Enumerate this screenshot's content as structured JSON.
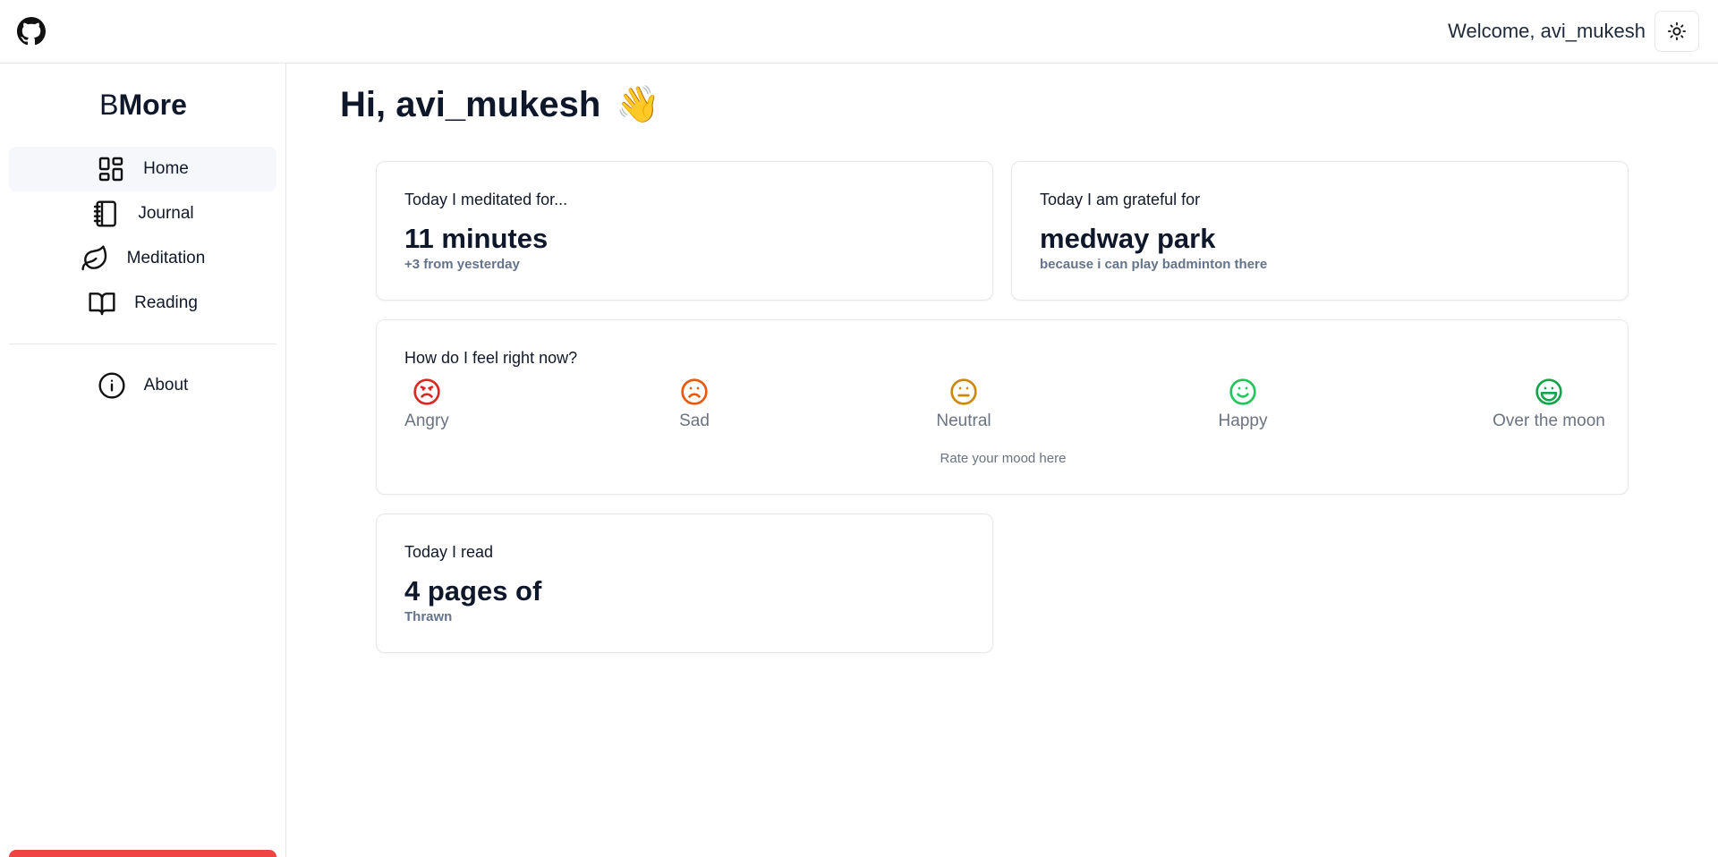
{
  "header": {
    "welcome": "Welcome, avi_mukesh",
    "github_icon": "github-icon",
    "theme_icon": "sun-icon"
  },
  "sidebar": {
    "brand_light": "B",
    "brand_bold": "More",
    "items": [
      {
        "label": "Home",
        "icon": "grid-icon"
      },
      {
        "label": "Journal",
        "icon": "notebook-icon"
      },
      {
        "label": "Meditation",
        "icon": "leaf-icon"
      },
      {
        "label": "Reading",
        "icon": "book-open-icon"
      }
    ],
    "about": {
      "label": "About",
      "icon": "info-icon"
    }
  },
  "main": {
    "greeting": "Hi, avi_mukesh",
    "wave": "👋",
    "meditation": {
      "label": "Today I meditated for...",
      "value": "11 minutes",
      "sub": "+3 from yesterday"
    },
    "gratitude": {
      "label": "Today I am grateful for",
      "value": "medway park",
      "sub": "because i can play badminton there"
    },
    "mood": {
      "label": "How do I feel right now?",
      "options": [
        {
          "label": "Angry",
          "color": "#dc2626"
        },
        {
          "label": "Sad",
          "color": "#ea580c"
        },
        {
          "label": "Neutral",
          "color": "#ca8a04"
        },
        {
          "label": "Happy",
          "color": "#22c55e"
        },
        {
          "label": "Over the moon",
          "color": "#16a34a"
        }
      ],
      "hint": "Rate your mood here"
    },
    "reading": {
      "label": "Today I read",
      "value": "4 pages of",
      "sub": "Thrawn"
    }
  },
  "colors": {
    "accent_red": "#ef4444",
    "muted": "#64748b"
  }
}
